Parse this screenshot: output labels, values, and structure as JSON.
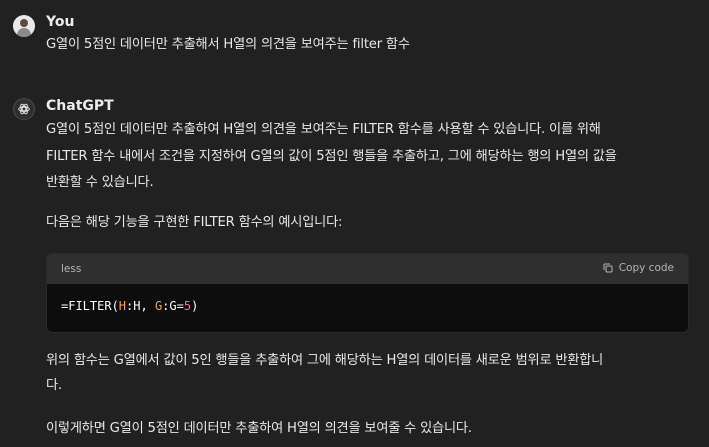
{
  "user": {
    "name": "You",
    "message": "G열이 5점인 데이터만 추출해서 H열의 의견을 보여주는 filter 함수"
  },
  "assistant": {
    "name": "ChatGPT",
    "intro_line1": "G열이 5점인 데이터만 추출하여 H열의 의견을 보여주는 FILTER 함수를 사용할 수 있습니다. 이를 위해",
    "intro_line2": "FILTER 함수 내에서 조건을 지정하여 G열의 값이 5점인 행들을 추출하고, 그에 해당하는 행의 H열의 값을",
    "intro_line3": "반환할 수 있습니다.",
    "example_intro": "다음은 해당 기능을 구현한 FILTER 함수의 예시입니다:",
    "code": {
      "language": "less",
      "copy_label": "Copy code",
      "tokens": [
        "=FILTER(",
        "H",
        ":H, ",
        "G",
        ":G=",
        "5",
        ")"
      ]
    },
    "explain_line1": "위의 함수는 G열에서 값이 5인 행들을 추출하여 그에 해당하는 H열의 데이터를 새로운 범위로 반환합니",
    "explain_line2": "다.",
    "conclusion": "이렇게하면 G열이 5점인 데이터만 추출하여 H열의 의견을 보여줄 수 있습니다."
  },
  "colors": {
    "background": "#212121",
    "code_background": "#0d0d0d",
    "code_header": "#2f2f2f",
    "column_token": "#f0a35e",
    "number_token": "#ff6b9d"
  },
  "icons": [
    "user-avatar",
    "chatgpt-logo-icon",
    "copy-icon"
  ]
}
